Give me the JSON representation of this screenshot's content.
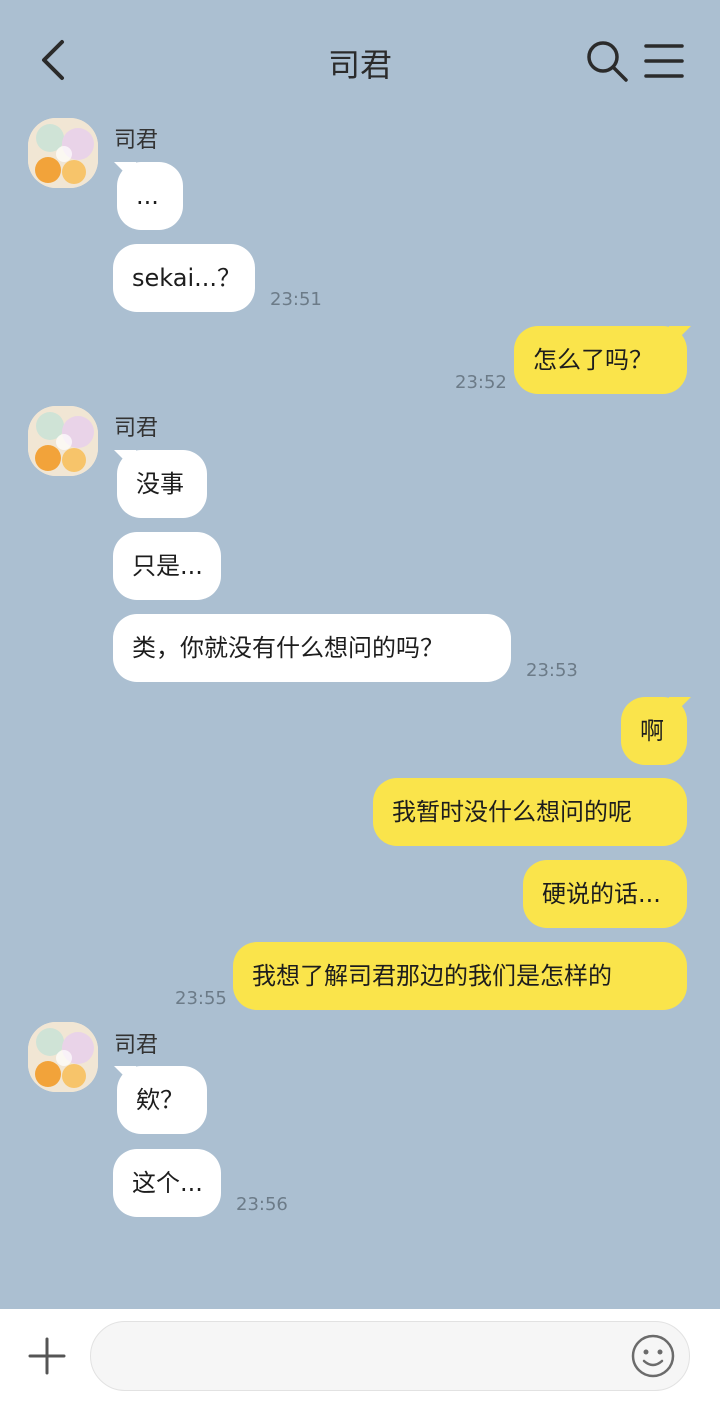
{
  "header": {
    "title": "司君"
  },
  "messages": {
    "g1_name": "司君",
    "m1": "...",
    "m2": "sekai...？",
    "t1": "23:51",
    "m3": "怎么了吗？",
    "t2": "23:52",
    "g2_name": "司君",
    "m4": "没事",
    "m5": "只是...",
    "m6": "类，你就没有什么想问的吗？",
    "t3": "23:53",
    "m7": "啊",
    "m8": "我暂时没什么想问的呢",
    "m9": "硬说的话...",
    "m10": "我想了解司君那边的我们是怎样的",
    "t4": "23:55",
    "g3_name": "司君",
    "m11": "欸？",
    "m12": "这个...",
    "t5": "23:56"
  },
  "input": {
    "placeholder": ""
  },
  "icons": {
    "back": "chevron-left-icon",
    "search": "search-icon",
    "menu": "menu-icon",
    "plus": "plus-icon",
    "emoji": "smiley-icon"
  },
  "colors": {
    "background": "#abbfd1",
    "incoming_bubble": "#ffffff",
    "outgoing_bubble": "#fae44b",
    "timestamp": "#6c7b88"
  }
}
